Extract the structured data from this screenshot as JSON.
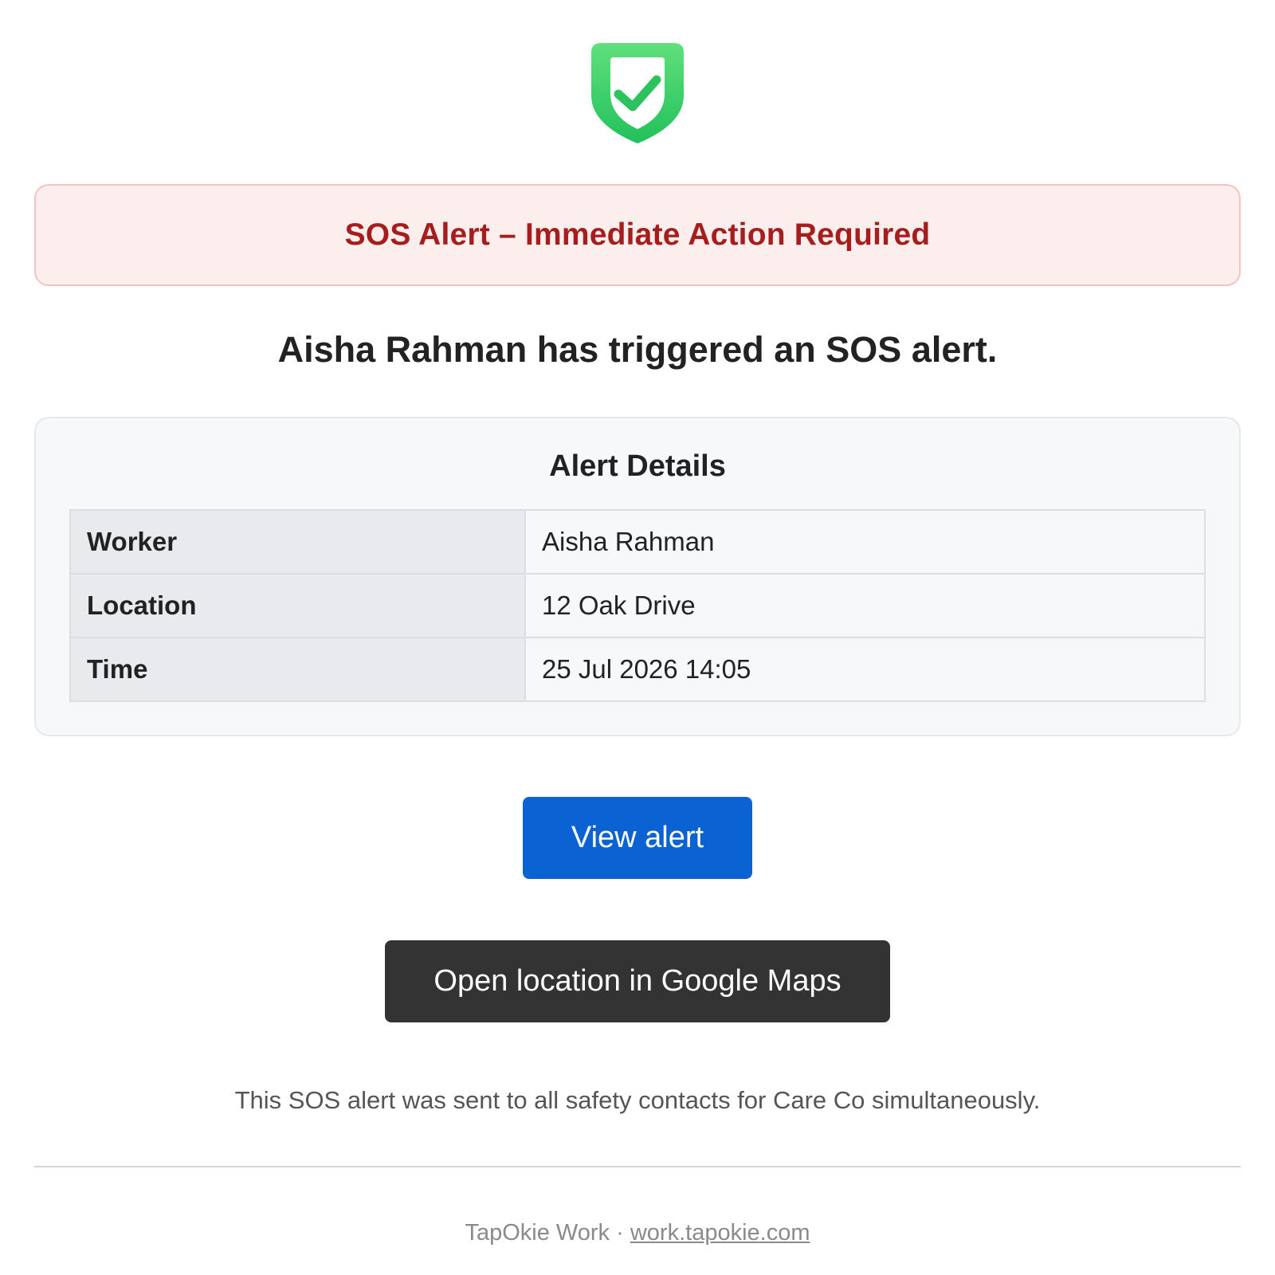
{
  "logo": {
    "icon": "shield-check-icon",
    "color_top": "#5fe07c",
    "color_bottom": "#22c05a"
  },
  "banner": {
    "text": "SOS Alert – Immediate Action Required",
    "text_color": "#a51d1d",
    "background": "#fdeeee",
    "border": "#f5c2c2"
  },
  "headline": "Aisha Rahman has triggered an SOS alert.",
  "details": {
    "title": "Alert Details",
    "rows": [
      {
        "label": "Worker",
        "value": "Aisha Rahman"
      },
      {
        "label": "Location",
        "value": "12 Oak Drive"
      },
      {
        "label": "Time",
        "value": "25 Jul 2026 14:05"
      }
    ]
  },
  "actions": {
    "view_alert_label": "View alert",
    "view_alert_color": "#0b63d3",
    "open_maps_label": "Open location in Google Maps",
    "open_maps_color": "#333333"
  },
  "note": "This SOS alert was sent to all safety contacts for Care Co simultaneously.",
  "footer": {
    "brand": "TapOkie Work",
    "separator": "·",
    "link_text": "work.tapokie.com"
  }
}
